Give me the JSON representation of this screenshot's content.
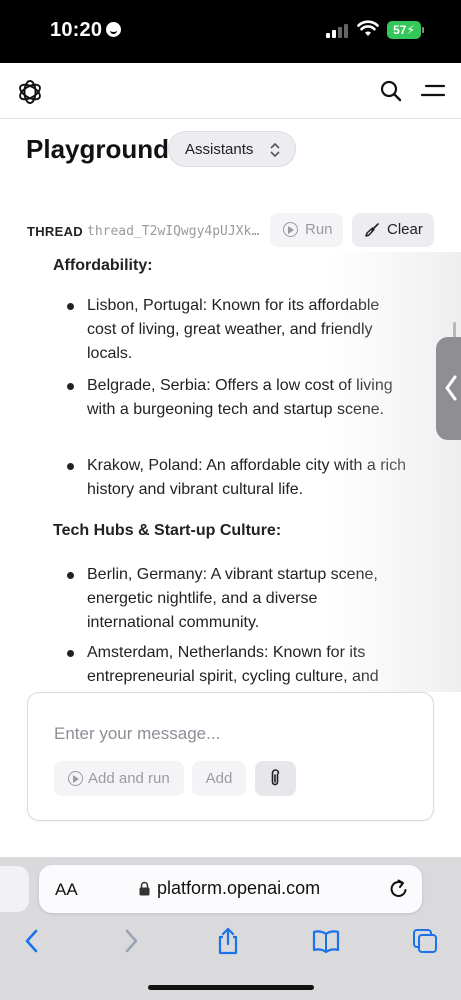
{
  "status_bar": {
    "time": "10:20",
    "battery": "57"
  },
  "header": {
    "logo_icon": "openai-logo-icon",
    "search_icon": "search-icon",
    "menu_icon": "menu-icon"
  },
  "page": {
    "title": "Playground",
    "mode": "Assistants"
  },
  "thread": {
    "label": "THREAD",
    "id": "thread_T2wIQwgy4pUJXk…",
    "run_label": "Run",
    "clear_label": "Clear"
  },
  "message": {
    "sections": [
      {
        "heading": "Affordability:",
        "items": [
          "Lisbon, Portugal: Known for its affordable cost of living, great weather, and friendly locals.",
          "Belgrade, Serbia: Offers a low cost of living with a burgeoning tech and startup scene.",
          "Krakow, Poland: An affordable city with a rich history and vibrant cultural life."
        ]
      },
      {
        "heading": "Tech Hubs & Start-up Culture:",
        "items": [
          "Berlin, Germany: A vibrant startup scene, energetic nightlife, and a diverse international community.",
          "Amsterdam, Netherlands: Known for its entrepreneurial spirit, cycling culture, and"
        ]
      }
    ]
  },
  "composer": {
    "placeholder": "Enter your message...",
    "add_and_run": "Add and run",
    "add": "Add"
  },
  "browser": {
    "text_size": "AA",
    "url": "platform.openai.com"
  }
}
